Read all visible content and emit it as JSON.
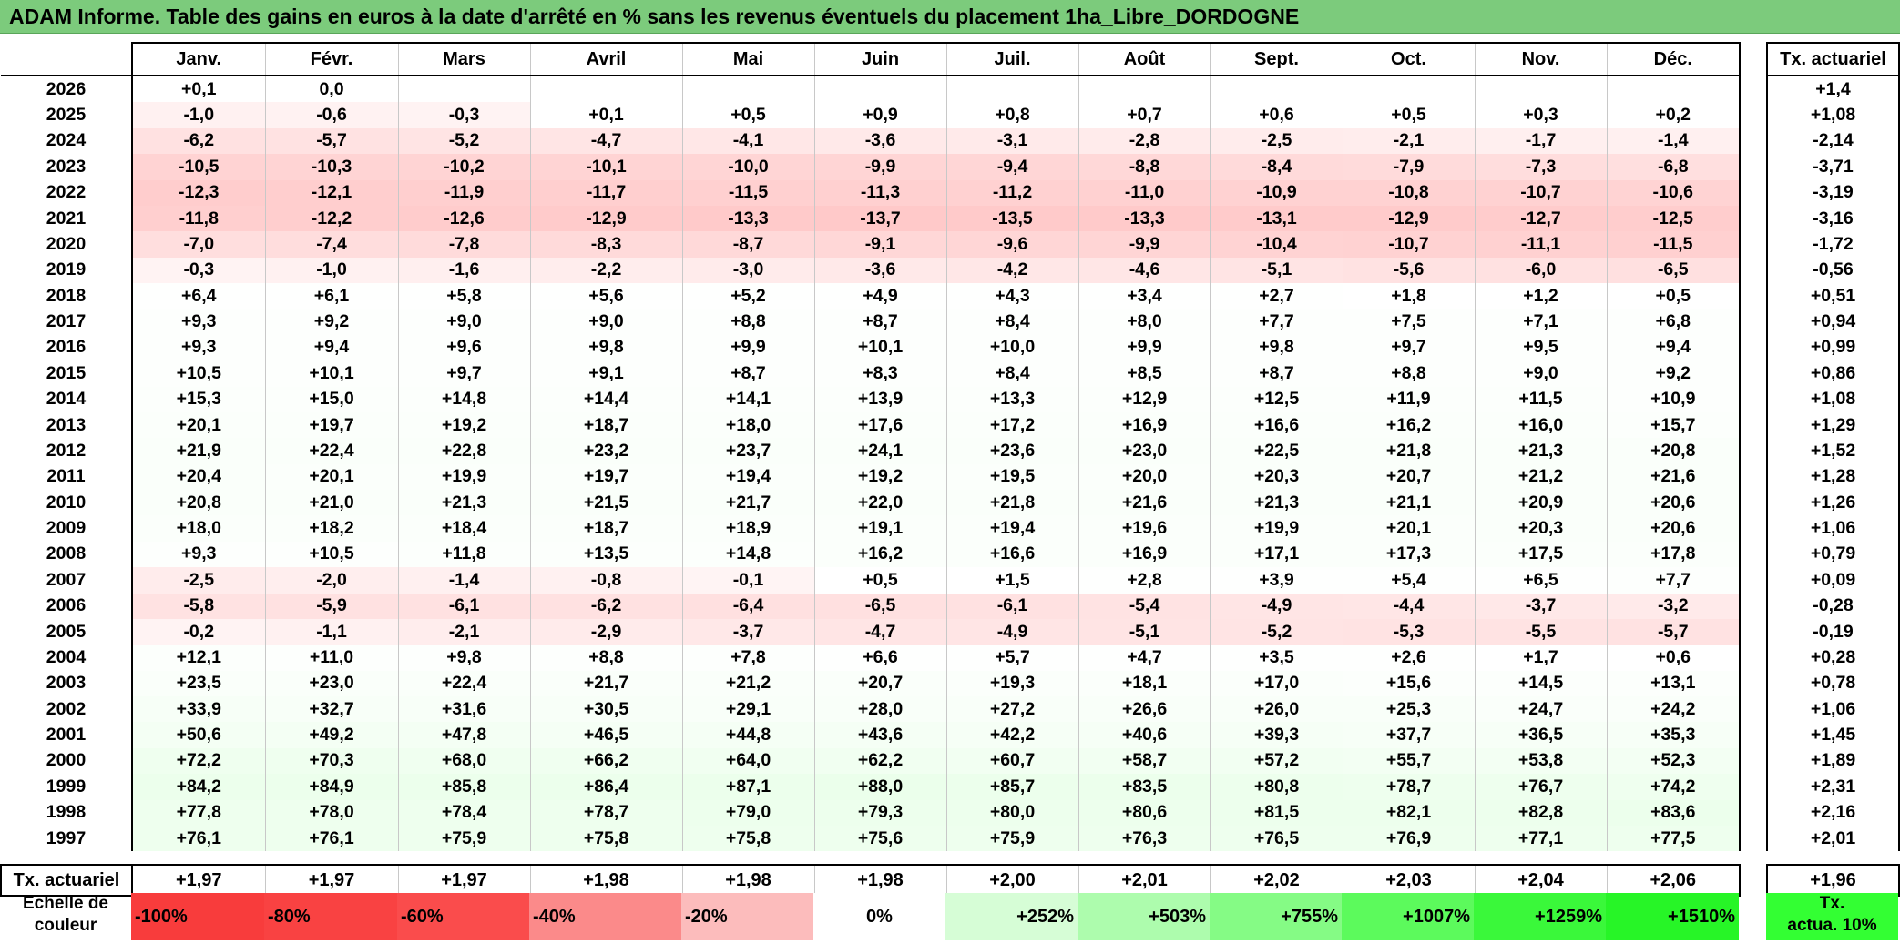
{
  "title": "ADAM Informe. Table des gains en euros à la date d'arrêté en % sans les revenus éventuels du placement 1ha_Libre_DORDOGNE",
  "months": [
    "Janv.",
    "Févr.",
    "Mars",
    "Avril",
    "Mai",
    "Juin",
    "Juil.",
    "Août",
    "Sept.",
    "Oct.",
    "Nov.",
    "Déc."
  ],
  "side_header": "Tx. actuariel",
  "rows": [
    {
      "year": "2026",
      "values": [
        "+0,1",
        "0,0",
        "",
        "",
        "",
        "",
        "",
        "",
        "",
        "",
        "",
        ""
      ],
      "tx": "+1,4"
    },
    {
      "year": "2025",
      "values": [
        "-1,0",
        "-0,6",
        "-0,3",
        "+0,1",
        "+0,5",
        "+0,9",
        "+0,8",
        "+0,7",
        "+0,6",
        "+0,5",
        "+0,3",
        "+0,2"
      ],
      "tx": "+1,08"
    },
    {
      "year": "2024",
      "values": [
        "-6,2",
        "-5,7",
        "-5,2",
        "-4,7",
        "-4,1",
        "-3,6",
        "-3,1",
        "-2,8",
        "-2,5",
        "-2,1",
        "-1,7",
        "-1,4"
      ],
      "tx": "-2,14"
    },
    {
      "year": "2023",
      "values": [
        "-10,5",
        "-10,3",
        "-10,2",
        "-10,1",
        "-10,0",
        "-9,9",
        "-9,4",
        "-8,8",
        "-8,4",
        "-7,9",
        "-7,3",
        "-6,8"
      ],
      "tx": "-3,71"
    },
    {
      "year": "2022",
      "values": [
        "-12,3",
        "-12,1",
        "-11,9",
        "-11,7",
        "-11,5",
        "-11,3",
        "-11,2",
        "-11,0",
        "-10,9",
        "-10,8",
        "-10,7",
        "-10,6"
      ],
      "tx": "-3,19"
    },
    {
      "year": "2021",
      "values": [
        "-11,8",
        "-12,2",
        "-12,6",
        "-12,9",
        "-13,3",
        "-13,7",
        "-13,5",
        "-13,3",
        "-13,1",
        "-12,9",
        "-12,7",
        "-12,5"
      ],
      "tx": "-3,16"
    },
    {
      "year": "2020",
      "values": [
        "-7,0",
        "-7,4",
        "-7,8",
        "-8,3",
        "-8,7",
        "-9,1",
        "-9,6",
        "-9,9",
        "-10,4",
        "-10,7",
        "-11,1",
        "-11,5"
      ],
      "tx": "-1,72"
    },
    {
      "year": "2019",
      "values": [
        "-0,3",
        "-1,0",
        "-1,6",
        "-2,2",
        "-3,0",
        "-3,6",
        "-4,2",
        "-4,6",
        "-5,1",
        "-5,6",
        "-6,0",
        "-6,5"
      ],
      "tx": "-0,56"
    },
    {
      "year": "2018",
      "values": [
        "+6,4",
        "+6,1",
        "+5,8",
        "+5,6",
        "+5,2",
        "+4,9",
        "+4,3",
        "+3,4",
        "+2,7",
        "+1,8",
        "+1,2",
        "+0,5"
      ],
      "tx": "+0,51"
    },
    {
      "year": "2017",
      "values": [
        "+9,3",
        "+9,2",
        "+9,0",
        "+9,0",
        "+8,8",
        "+8,7",
        "+8,4",
        "+8,0",
        "+7,7",
        "+7,5",
        "+7,1",
        "+6,8"
      ],
      "tx": "+0,94"
    },
    {
      "year": "2016",
      "values": [
        "+9,3",
        "+9,4",
        "+9,6",
        "+9,8",
        "+9,9",
        "+10,1",
        "+10,0",
        "+9,9",
        "+9,8",
        "+9,7",
        "+9,5",
        "+9,4"
      ],
      "tx": "+0,99"
    },
    {
      "year": "2015",
      "values": [
        "+10,5",
        "+10,1",
        "+9,7",
        "+9,1",
        "+8,7",
        "+8,3",
        "+8,4",
        "+8,5",
        "+8,7",
        "+8,8",
        "+9,0",
        "+9,2"
      ],
      "tx": "+0,86"
    },
    {
      "year": "2014",
      "values": [
        "+15,3",
        "+15,0",
        "+14,8",
        "+14,4",
        "+14,1",
        "+13,9",
        "+13,3",
        "+12,9",
        "+12,5",
        "+11,9",
        "+11,5",
        "+10,9"
      ],
      "tx": "+1,08"
    },
    {
      "year": "2013",
      "values": [
        "+20,1",
        "+19,7",
        "+19,2",
        "+18,7",
        "+18,0",
        "+17,6",
        "+17,2",
        "+16,9",
        "+16,6",
        "+16,2",
        "+16,0",
        "+15,7"
      ],
      "tx": "+1,29"
    },
    {
      "year": "2012",
      "values": [
        "+21,9",
        "+22,4",
        "+22,8",
        "+23,2",
        "+23,7",
        "+24,1",
        "+23,6",
        "+23,0",
        "+22,5",
        "+21,8",
        "+21,3",
        "+20,8"
      ],
      "tx": "+1,52"
    },
    {
      "year": "2011",
      "values": [
        "+20,4",
        "+20,1",
        "+19,9",
        "+19,7",
        "+19,4",
        "+19,2",
        "+19,5",
        "+20,0",
        "+20,3",
        "+20,7",
        "+21,2",
        "+21,6"
      ],
      "tx": "+1,28"
    },
    {
      "year": "2010",
      "values": [
        "+20,8",
        "+21,0",
        "+21,3",
        "+21,5",
        "+21,7",
        "+22,0",
        "+21,8",
        "+21,6",
        "+21,3",
        "+21,1",
        "+20,9",
        "+20,6"
      ],
      "tx": "+1,26"
    },
    {
      "year": "2009",
      "values": [
        "+18,0",
        "+18,2",
        "+18,4",
        "+18,7",
        "+18,9",
        "+19,1",
        "+19,4",
        "+19,6",
        "+19,9",
        "+20,1",
        "+20,3",
        "+20,6"
      ],
      "tx": "+1,06"
    },
    {
      "year": "2008",
      "values": [
        "+9,3",
        "+10,5",
        "+11,8",
        "+13,5",
        "+14,8",
        "+16,2",
        "+16,6",
        "+16,9",
        "+17,1",
        "+17,3",
        "+17,5",
        "+17,8"
      ],
      "tx": "+0,79"
    },
    {
      "year": "2007",
      "values": [
        "-2,5",
        "-2,0",
        "-1,4",
        "-0,8",
        "-0,1",
        "+0,5",
        "+1,5",
        "+2,8",
        "+3,9",
        "+5,4",
        "+6,5",
        "+7,7"
      ],
      "tx": "+0,09"
    },
    {
      "year": "2006",
      "values": [
        "-5,8",
        "-5,9",
        "-6,1",
        "-6,2",
        "-6,4",
        "-6,5",
        "-6,1",
        "-5,4",
        "-4,9",
        "-4,4",
        "-3,7",
        "-3,2"
      ],
      "tx": "-0,28"
    },
    {
      "year": "2005",
      "values": [
        "-0,2",
        "-1,1",
        "-2,1",
        "-2,9",
        "-3,7",
        "-4,7",
        "-4,9",
        "-5,1",
        "-5,2",
        "-5,3",
        "-5,5",
        "-5,7"
      ],
      "tx": "-0,19"
    },
    {
      "year": "2004",
      "values": [
        "+12,1",
        "+11,0",
        "+9,8",
        "+8,8",
        "+7,8",
        "+6,6",
        "+5,7",
        "+4,7",
        "+3,5",
        "+2,6",
        "+1,7",
        "+0,6"
      ],
      "tx": "+0,28"
    },
    {
      "year": "2003",
      "values": [
        "+23,5",
        "+23,0",
        "+22,4",
        "+21,7",
        "+21,2",
        "+20,7",
        "+19,3",
        "+18,1",
        "+17,0",
        "+15,6",
        "+14,5",
        "+13,1"
      ],
      "tx": "+0,78"
    },
    {
      "year": "2002",
      "values": [
        "+33,9",
        "+32,7",
        "+31,6",
        "+30,5",
        "+29,1",
        "+28,0",
        "+27,2",
        "+26,6",
        "+26,0",
        "+25,3",
        "+24,7",
        "+24,2"
      ],
      "tx": "+1,06"
    },
    {
      "year": "2001",
      "values": [
        "+50,6",
        "+49,2",
        "+47,8",
        "+46,5",
        "+44,8",
        "+43,6",
        "+42,2",
        "+40,6",
        "+39,3",
        "+37,7",
        "+36,5",
        "+35,3"
      ],
      "tx": "+1,45"
    },
    {
      "year": "2000",
      "values": [
        "+72,2",
        "+70,3",
        "+68,0",
        "+66,2",
        "+64,0",
        "+62,2",
        "+60,7",
        "+58,7",
        "+57,2",
        "+55,7",
        "+53,8",
        "+52,3"
      ],
      "tx": "+1,89"
    },
    {
      "year": "1999",
      "values": [
        "+84,2",
        "+84,9",
        "+85,8",
        "+86,4",
        "+87,1",
        "+88,0",
        "+85,7",
        "+83,5",
        "+80,8",
        "+78,7",
        "+76,7",
        "+74,2"
      ],
      "tx": "+2,31"
    },
    {
      "year": "1998",
      "values": [
        "+77,8",
        "+78,0",
        "+78,4",
        "+78,7",
        "+79,0",
        "+79,3",
        "+80,0",
        "+80,6",
        "+81,5",
        "+82,1",
        "+82,8",
        "+83,6"
      ],
      "tx": "+2,16"
    },
    {
      "year": "1997",
      "values": [
        "+76,1",
        "+76,1",
        "+75,9",
        "+75,8",
        "+75,8",
        "+75,6",
        "+75,9",
        "+76,3",
        "+76,5",
        "+76,9",
        "+77,1",
        "+77,5"
      ],
      "tx": "+2,01"
    }
  ],
  "tx_row": {
    "label": "Tx. actuariel",
    "values": [
      "+1,97",
      "+1,97",
      "+1,97",
      "+1,98",
      "+1,98",
      "+1,98",
      "+2,00",
      "+2,01",
      "+2,02",
      "+2,03",
      "+2,04",
      "+2,06"
    ],
    "tx": "+1,96"
  },
  "legend": {
    "label_line1": "Echelle de",
    "label_line2": "couleur",
    "cells": [
      {
        "text": "-100%",
        "color": "#f83c3c",
        "align": "left"
      },
      {
        "text": "-80%",
        "color": "#f94242",
        "align": "left"
      },
      {
        "text": "-60%",
        "color": "#fa4c4c",
        "align": "left"
      },
      {
        "text": "-40%",
        "color": "#fb8a8a",
        "align": "left"
      },
      {
        "text": "-20%",
        "color": "#fcbcbc",
        "align": "left"
      },
      {
        "text": "0%",
        "color": "#ffffff",
        "align": "center"
      },
      {
        "text": "+252%",
        "color": "#d6fdd6",
        "align": "right"
      },
      {
        "text": "+503%",
        "color": "#adfcad",
        "align": "right"
      },
      {
        "text": "+755%",
        "color": "#85fb85",
        "align": "right"
      },
      {
        "text": "+1007%",
        "color": "#5cfa5c",
        "align": "right"
      },
      {
        "text": "+1259%",
        "color": "#3af83a",
        "align": "right"
      },
      {
        "text": "+1510%",
        "color": "#27f527",
        "align": "right"
      }
    ],
    "tx_line1": "Tx.",
    "tx_line2": "actua. 10%"
  }
}
